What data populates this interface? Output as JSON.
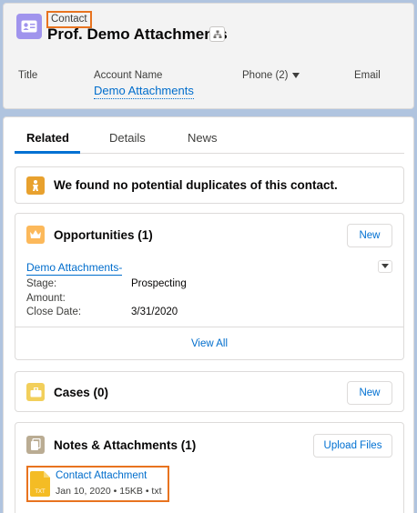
{
  "header": {
    "object_type": "Contact",
    "record_name": "Prof. Demo Attachments",
    "icon": "contact-card-icon",
    "hierarchy_icon": "hierarchy-icon",
    "fields": {
      "title_label": "Title",
      "account_label": "Account Name",
      "account_value": "Demo Attachments",
      "phone_label": "Phone (2)",
      "email_label": "Email"
    }
  },
  "tabs": [
    {
      "label": "Related",
      "active": true
    },
    {
      "label": "Details",
      "active": false
    },
    {
      "label": "News",
      "active": false
    }
  ],
  "duplicates": {
    "message": "We found no potential duplicates of this contact.",
    "icon": "duplicate-person-icon",
    "color": "#e8a12e"
  },
  "opportunities": {
    "title": "Opportunities (1)",
    "icon": "crown-icon",
    "color": "#fcb95b",
    "new_label": "New",
    "record": {
      "name": "Demo Attachments-",
      "rows": [
        {
          "label": "Stage:",
          "value": "Prospecting"
        },
        {
          "label": "Amount:",
          "value": ""
        },
        {
          "label": "Close Date:",
          "value": "3/31/2020"
        }
      ]
    },
    "view_all": "View All"
  },
  "cases": {
    "title": "Cases (0)",
    "icon": "briefcase-icon",
    "color": "#f2cf5b",
    "new_label": "New"
  },
  "notes": {
    "title": "Notes & Attachments (1)",
    "icon": "file-stack-icon",
    "color": "#baac93",
    "upload_label": "Upload Files",
    "attachment": {
      "name": "Contact Attachment",
      "meta": "Jan 10, 2020 • 15KB • txt",
      "file_type": "TXT"
    }
  }
}
